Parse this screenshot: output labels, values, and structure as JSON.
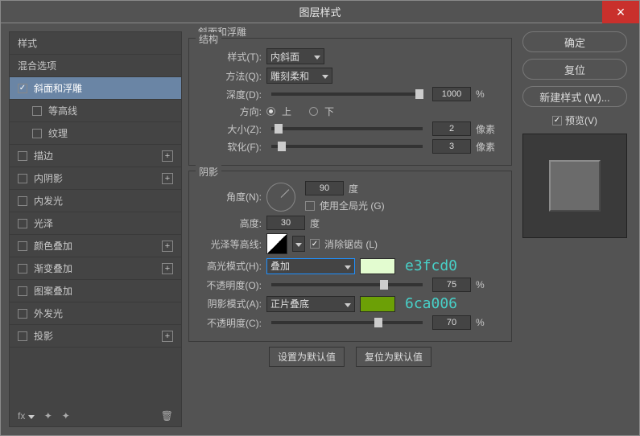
{
  "title": "图层样式",
  "sidebar": {
    "header": "样式",
    "blend": "混合选项",
    "items": [
      {
        "id": "bevel",
        "label": "斜面和浮雕",
        "checked": true,
        "selected": true
      },
      {
        "id": "contour",
        "label": "等高线",
        "indent": true
      },
      {
        "id": "texture",
        "label": "纹理",
        "indent": true
      },
      {
        "id": "stroke",
        "label": "描边",
        "plus": true
      },
      {
        "id": "inner-shadow",
        "label": "内阴影",
        "plus": true
      },
      {
        "id": "inner-glow",
        "label": "内发光"
      },
      {
        "id": "satin",
        "label": "光泽"
      },
      {
        "id": "color-overlay",
        "label": "颜色叠加",
        "plus": true
      },
      {
        "id": "gradient-overlay",
        "label": "渐变叠加",
        "plus": true
      },
      {
        "id": "pattern-overlay",
        "label": "图案叠加"
      },
      {
        "id": "outer-glow",
        "label": "外发光"
      },
      {
        "id": "drop-shadow",
        "label": "投影",
        "plus": true
      }
    ],
    "fx": "fx"
  },
  "main": {
    "bevel_title": "斜面和浮雕",
    "structure": "结构",
    "style_label": "样式(T):",
    "style_value": "内斜面",
    "method_label": "方法(Q):",
    "method_value": "雕刻柔和",
    "depth_label": "深度(D):",
    "depth_value": "1000",
    "percent": "%",
    "direction_label": "方向:",
    "up": "上",
    "down": "下",
    "size_label": "大小(Z):",
    "size_value": "2",
    "px": "像素",
    "soften_label": "软化(F):",
    "soften_value": "3",
    "shadow": "阴影",
    "angle_label": "角度(N):",
    "angle_value": "90",
    "deg": "度",
    "global_label": "使用全局光 (G)",
    "altitude_label": "高度:",
    "altitude_value": "30",
    "gloss_label": "光泽等高线:",
    "antialias_label": "消除锯齿 (L)",
    "hl_mode_label": "高光模式(H):",
    "hl_mode_value": "叠加",
    "hl_opacity_label": "不透明度(O):",
    "hl_opacity_value": "75",
    "sh_mode_label": "阴影模式(A):",
    "sh_mode_value": "正片叠底",
    "sh_opacity_label": "不透明度(C):",
    "sh_opacity_value": "70",
    "hl_hex": "e3fcd0",
    "sh_hex": "6ca006",
    "hl_color": "#e3fcd0",
    "sh_color": "#6ca006",
    "set_default": "设置为默认值",
    "reset_default": "复位为默认值"
  },
  "right": {
    "ok": "确定",
    "cancel": "复位",
    "new_style": "新建样式 (W)...",
    "preview": "预览(V)"
  }
}
